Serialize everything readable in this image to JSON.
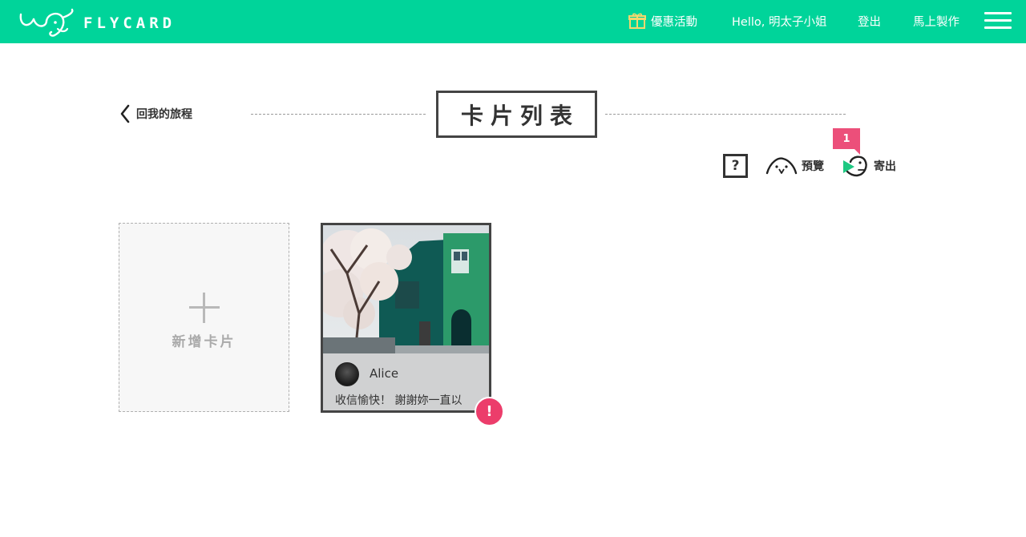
{
  "brand": {
    "name": "FLYCARD"
  },
  "nav": {
    "promo_label": "優惠活動",
    "greeting": "Hello, 明太子小姐",
    "logout_label": "登出",
    "make_label": "馬上製作"
  },
  "page": {
    "back_label": "回我的旅程",
    "title": "卡片列表"
  },
  "toolbar": {
    "help_label": "?",
    "preview_label": "預覽",
    "send_label": "寄出",
    "send_badge": "1"
  },
  "add_card": {
    "label": "新增卡片"
  },
  "cards": [
    {
      "sender": "Alice",
      "message": "收信愉快！ 謝謝妳一直以",
      "alert": "!"
    }
  ],
  "colors": {
    "brand_green": "#00d49a",
    "badge_pink": "#ec4f7a",
    "alert_pink": "#ec3d6b"
  }
}
